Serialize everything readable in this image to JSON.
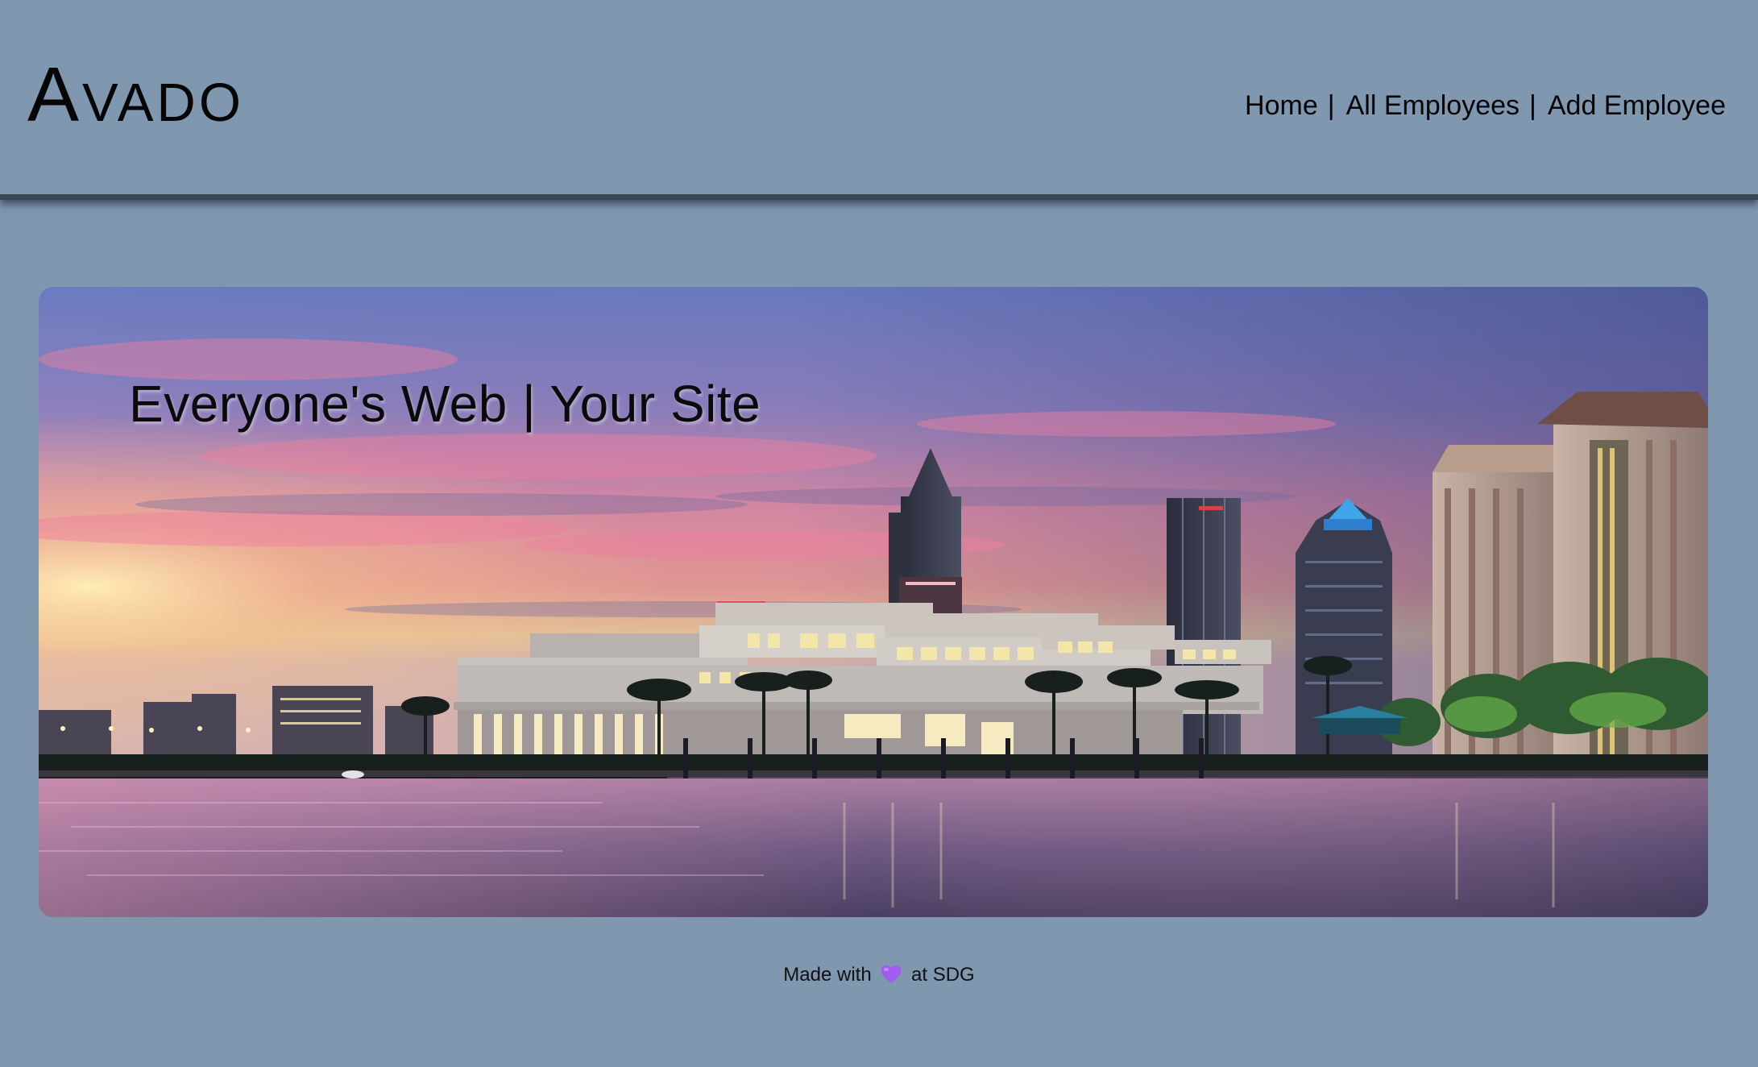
{
  "header": {
    "brand": "Avado",
    "nav": [
      {
        "label": "Home",
        "sep": "|"
      },
      {
        "label": "All Employees",
        "sep": "|"
      },
      {
        "label": "Add Employee",
        "sep": ""
      }
    ]
  },
  "hero": {
    "tagline": "Everyone's Web | Your Site",
    "image": "city-skyline-waterfront-sunset"
  },
  "footer": {
    "prefix": "Made with",
    "icon": "purple-heart-icon",
    "suffix": "at SDG"
  },
  "colors": {
    "background": "#8097b0",
    "header_rule": "#3a4654",
    "heart": "#a35cf0"
  }
}
